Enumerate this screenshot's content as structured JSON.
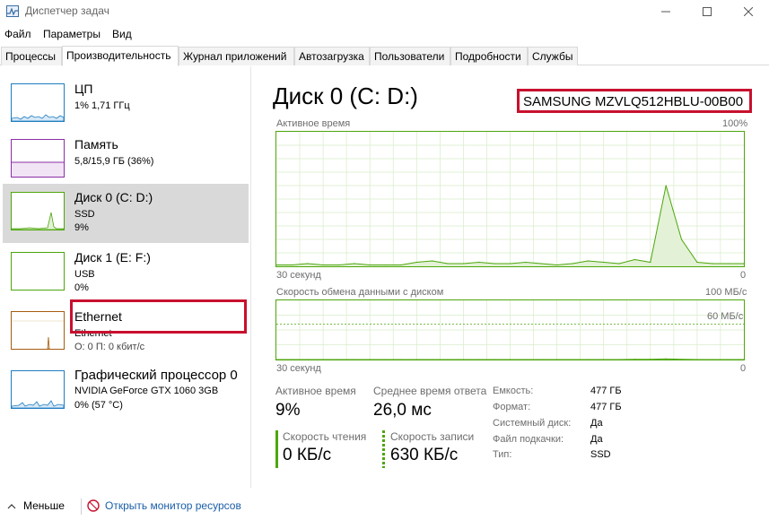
{
  "window": {
    "title": "Диспетчер задач"
  },
  "menu": [
    "Файл",
    "Параметры",
    "Вид"
  ],
  "tabs": [
    {
      "label": "Процессы",
      "active": false
    },
    {
      "label": "Производительность",
      "active": true
    },
    {
      "label": "Журнал приложений",
      "active": false
    },
    {
      "label": "Автозагрузка",
      "active": false
    },
    {
      "label": "Пользователи",
      "active": false
    },
    {
      "label": "Подробности",
      "active": false
    },
    {
      "label": "Службы",
      "active": false
    }
  ],
  "sidebar": {
    "items": [
      {
        "name": "ЦП",
        "sub1": "1% 1,71 ГГц",
        "sub2": "",
        "color": "#1f7dc1",
        "fill": "#d7e9f7",
        "selected": false
      },
      {
        "name": "Память",
        "sub1": "5,8/15,9 ГБ (36%)",
        "sub2": "",
        "color": "#8b2fa5",
        "fill": "#f1e4f5",
        "selected": false
      },
      {
        "name": "Диск 0 (C: D:)",
        "sub1": "SSD",
        "sub2": "9%",
        "color": "#4da60c",
        "fill": "#e3f2d6",
        "selected": true
      },
      {
        "name": "Диск 1 (E: F:)",
        "sub1": "USB",
        "sub2": "0%",
        "color": "#4da60c",
        "fill": "#e3f2d6",
        "selected": false
      },
      {
        "name": "Ethernet",
        "sub1": "Ethernet",
        "sub2": "О: 0 П: 0 кбит/с",
        "color": "#a55d10",
        "fill": "#f6e8d6",
        "selected": false
      },
      {
        "name": "Графический процессор 0",
        "sub1": "NVIDIA GeForce GTX 1060 3GB",
        "sub2": "0% (57 °C)",
        "color": "#1f7dc1",
        "fill": "#d7e9f7",
        "selected": false
      }
    ]
  },
  "main": {
    "title": "Диск 0 (C: D:)",
    "model": "SAMSUNG MZVLQ512HBLU-00B00",
    "active_time_chart": {
      "label": "Активное время",
      "max_label": "100%",
      "time_label": "30 секунд",
      "min_label": "0"
    },
    "transfer_chart": {
      "label": "Скорость обмена данными с диском",
      "max_label": "100 МБ/с",
      "mid_label": "60 МБ/с",
      "time_label": "30 секунд",
      "min_label": "0"
    },
    "stats": {
      "active_time_label": "Активное время",
      "active_time_value": "9%",
      "avg_response_label": "Среднее время ответа",
      "avg_response_value": "26,0 мс",
      "read_speed_label": "Скорость чтения",
      "read_speed_value": "0 КБ/с",
      "write_speed_label": "Скорость записи",
      "write_speed_value": "630 КБ/с"
    },
    "properties": [
      {
        "label": "Емкость:",
        "value": "477 ГБ"
      },
      {
        "label": "Формат:",
        "value": "477 ГБ"
      },
      {
        "label": "Системный диск:",
        "value": "Да"
      },
      {
        "label": "Файл подкачки:",
        "value": "Да"
      },
      {
        "label": "Тип:",
        "value": "SSD"
      }
    ]
  },
  "footer": {
    "less_label": "Меньше",
    "monitor_link": "Открыть монитор ресурсов"
  },
  "chart_data": [
    {
      "type": "area",
      "title": "Активное время",
      "ylim": [
        0,
        100
      ],
      "x": [
        0,
        1,
        2,
        3,
        4,
        5,
        6,
        7,
        8,
        9,
        10,
        11,
        12,
        13,
        14,
        15,
        16,
        17,
        18,
        19,
        20,
        21,
        22,
        23,
        24,
        25,
        26,
        27,
        28,
        29,
        30
      ],
      "values": [
        1,
        1,
        2,
        1,
        1,
        2,
        1,
        1,
        1,
        3,
        4,
        2,
        2,
        3,
        2,
        2,
        3,
        2,
        1,
        2,
        4,
        3,
        2,
        5,
        3,
        60,
        20,
        3,
        2,
        2,
        2
      ],
      "color": "#4da60c"
    },
    {
      "type": "area",
      "title": "Скорость обмена данными с диском",
      "ylim": [
        0,
        100
      ],
      "x": [
        0,
        1,
        2,
        3,
        4,
        5,
        6,
        7,
        8,
        9,
        10,
        11,
        12,
        13,
        14,
        15,
        16,
        17,
        18,
        19,
        20,
        21,
        22,
        23,
        24,
        25,
        26,
        27,
        28,
        29,
        30
      ],
      "values": [
        0,
        0,
        0,
        0,
        0,
        0,
        0,
        0,
        0,
        0,
        0,
        0,
        0,
        0,
        0,
        0,
        0,
        0,
        0,
        0,
        0,
        0,
        0,
        0.5,
        0.5,
        1,
        0.5,
        0,
        0,
        0,
        0
      ],
      "color": "#4da60c"
    }
  ]
}
